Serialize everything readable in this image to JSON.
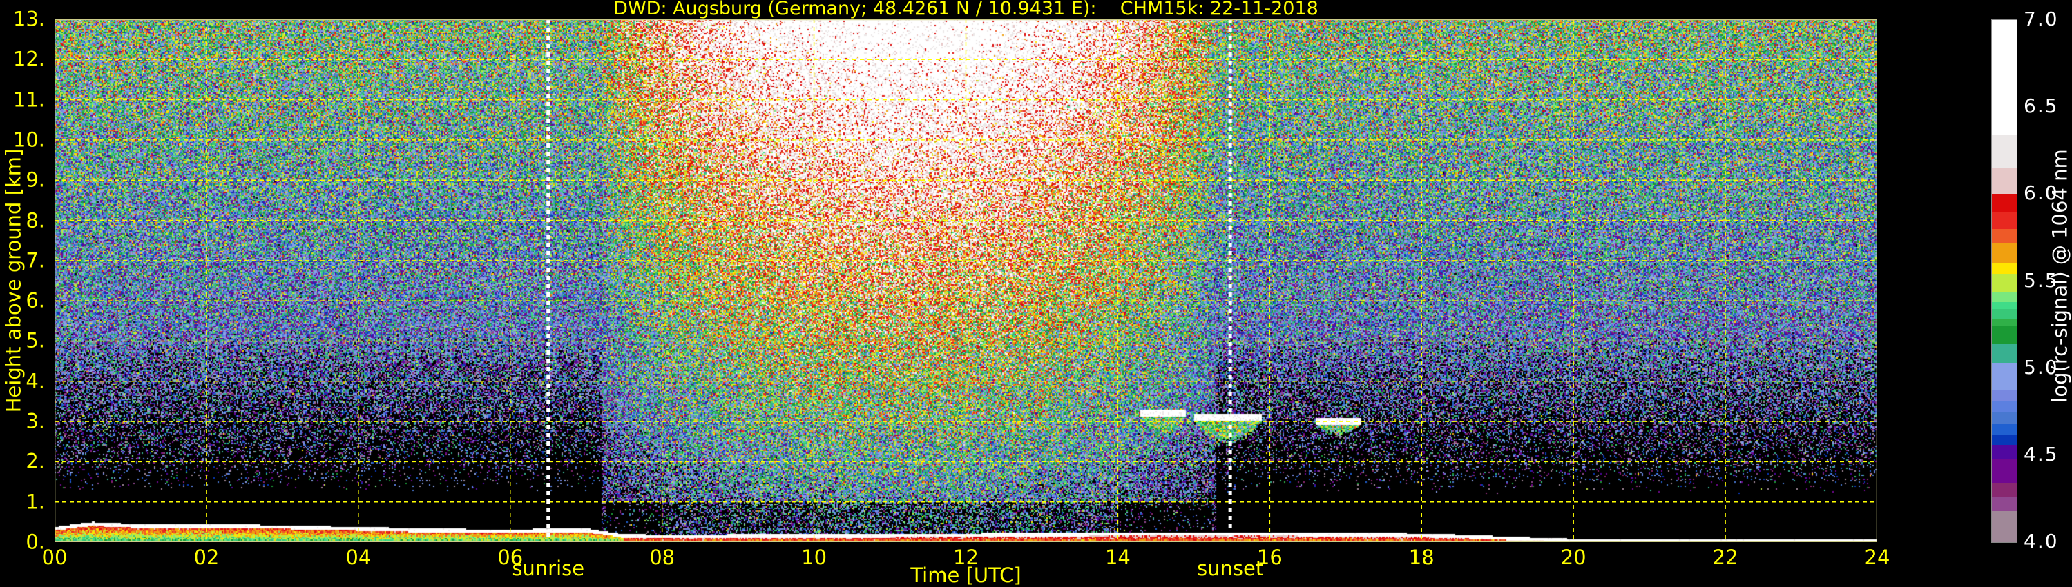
{
  "chart_data": {
    "type": "heatmap",
    "title": "DWD: Augsburg (Germany; 48.4261 N / 10.9431 E):    CHM15k: 22-11-2018",
    "xlabel": "Time [UTC]",
    "ylabel": "Height above ground [km]",
    "xlim": [
      0,
      24
    ],
    "ylim": [
      0,
      13
    ],
    "xticks": [
      "00",
      "02",
      "04",
      "06",
      "08",
      "10",
      "12",
      "14",
      "16",
      "18",
      "20",
      "22",
      "24"
    ],
    "xtick_values": [
      0,
      2,
      4,
      6,
      8,
      10,
      12,
      14,
      16,
      18,
      20,
      22,
      24
    ],
    "yticks": [
      "0.",
      "1.",
      "2.",
      "3.",
      "4.",
      "5.",
      "6.",
      "7.",
      "8.",
      "9.",
      "10.",
      "11.",
      "12.",
      "13."
    ],
    "ytick_values": [
      0,
      1,
      2,
      3,
      4,
      5,
      6,
      7,
      8,
      9,
      10,
      11,
      12,
      13
    ],
    "grid": true,
    "annotations": [
      {
        "label": "sunrise",
        "x": 6.5
      },
      {
        "label": "sunset",
        "x": 15.48
      }
    ],
    "colorbar": {
      "label": "log(rc-signal) @ 1064 nm",
      "range": [
        4.0,
        7.0
      ],
      "ticks": [
        "4.0",
        "4.5",
        "5.0",
        "5.5",
        "6.0",
        "6.5",
        "7.0"
      ],
      "tick_values": [
        4.0,
        4.5,
        5.0,
        5.5,
        6.0,
        6.5,
        7.0
      ],
      "levels": [
        {
          "from": 4.0,
          "to": 4.18,
          "color": "#a08898"
        },
        {
          "from": 4.18,
          "to": 4.26,
          "color": "#904890"
        },
        {
          "from": 4.26,
          "to": 4.34,
          "color": "#882870"
        },
        {
          "from": 4.34,
          "to": 4.48,
          "color": "#700890"
        },
        {
          "from": 4.48,
          "to": 4.56,
          "color": "#5008a0"
        },
        {
          "from": 4.56,
          "to": 4.62,
          "color": "#0838b8"
        },
        {
          "from": 4.62,
          "to": 4.68,
          "color": "#2060d0"
        },
        {
          "from": 4.68,
          "to": 4.75,
          "color": "#4878d0"
        },
        {
          "from": 4.75,
          "to": 4.81,
          "color": "#5c80e0"
        },
        {
          "from": 4.81,
          "to": 4.87,
          "color": "#7888e0"
        },
        {
          "from": 4.87,
          "to": 5.03,
          "color": "#88a0e8"
        },
        {
          "from": 5.03,
          "to": 5.14,
          "color": "#38b090"
        },
        {
          "from": 5.14,
          "to": 5.24,
          "color": "#1a9a34"
        },
        {
          "from": 5.24,
          "to": 5.28,
          "color": "#30b048"
        },
        {
          "from": 5.28,
          "to": 5.34,
          "color": "#38c878"
        },
        {
          "from": 5.34,
          "to": 5.38,
          "color": "#40dc88"
        },
        {
          "from": 5.38,
          "to": 5.44,
          "color": "#7ae87e"
        },
        {
          "from": 5.44,
          "to": 5.54,
          "color": "#c0ea40"
        },
        {
          "from": 5.54,
          "to": 5.6,
          "color": "#ffe600"
        },
        {
          "from": 5.6,
          "to": 5.72,
          "color": "#f0a010"
        },
        {
          "from": 5.72,
          "to": 5.8,
          "color": "#ee5a28"
        },
        {
          "from": 5.8,
          "to": 5.9,
          "color": "#e82820"
        },
        {
          "from": 5.9,
          "to": 6.0,
          "color": "#dc0a0a"
        },
        {
          "from": 6.0,
          "to": 6.15,
          "color": "#e6c8c8"
        },
        {
          "from": 6.15,
          "to": 6.34,
          "color": "#ece8e8"
        },
        {
          "from": 6.34,
          "to": 7.0,
          "color": "#ffffff"
        }
      ]
    },
    "boundary_layer_top_km": {
      "hours": [
        0,
        0.5,
        1,
        2,
        3,
        4,
        5,
        6,
        7,
        7.5,
        8,
        10,
        12,
        14,
        16,
        18,
        20,
        22,
        24
      ],
      "values": [
        0.38,
        0.5,
        0.45,
        0.45,
        0.42,
        0.38,
        0.33,
        0.32,
        0.34,
        0.2,
        0.18,
        0.2,
        0.22,
        0.25,
        0.25,
        0.22,
        0.08,
        0.08,
        0.08
      ]
    },
    "cloud_layers": [
      {
        "start": 14.3,
        "end": 14.9,
        "base_km": 2.7,
        "top_km": 3.3
      },
      {
        "start": 15.0,
        "end": 15.9,
        "base_km": 2.5,
        "top_km": 3.2
      },
      {
        "start": 16.6,
        "end": 17.2,
        "base_km": 2.8,
        "top_km": 3.1
      }
    ],
    "colors": {
      "axis_text": "#ffff00",
      "grid": "#ffff00",
      "background": "#000000",
      "sun_lines": "#ffffff"
    }
  }
}
